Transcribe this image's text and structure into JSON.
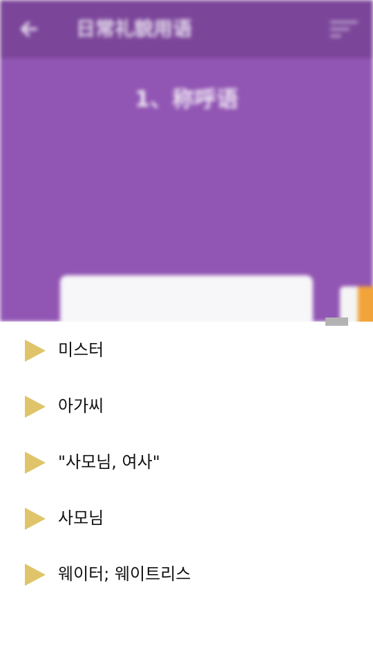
{
  "app_bar": {
    "title": "日常礼貌用语",
    "back_icon": "arrow-left-icon",
    "sort_icon": "sort-icon"
  },
  "lesson": {
    "title": "1、称呼语"
  },
  "colors": {
    "app_bar": "#7b4599",
    "content_bg": "#9155b3",
    "play_icon": "#e0c46a",
    "word_text": "#111111",
    "handle": "#b3b3b3"
  },
  "word_list": [
    {
      "text": "미스터",
      "icon": "play-triangle-icon"
    },
    {
      "text": "아가씨",
      "icon": "play-triangle-icon"
    },
    {
      "text": "\"사모님, 여사\"",
      "icon": "play-triangle-icon"
    },
    {
      "text": "사모님",
      "icon": "play-triangle-icon"
    },
    {
      "text": "웨이터; 웨이트리스",
      "icon": "play-triangle-icon"
    }
  ]
}
